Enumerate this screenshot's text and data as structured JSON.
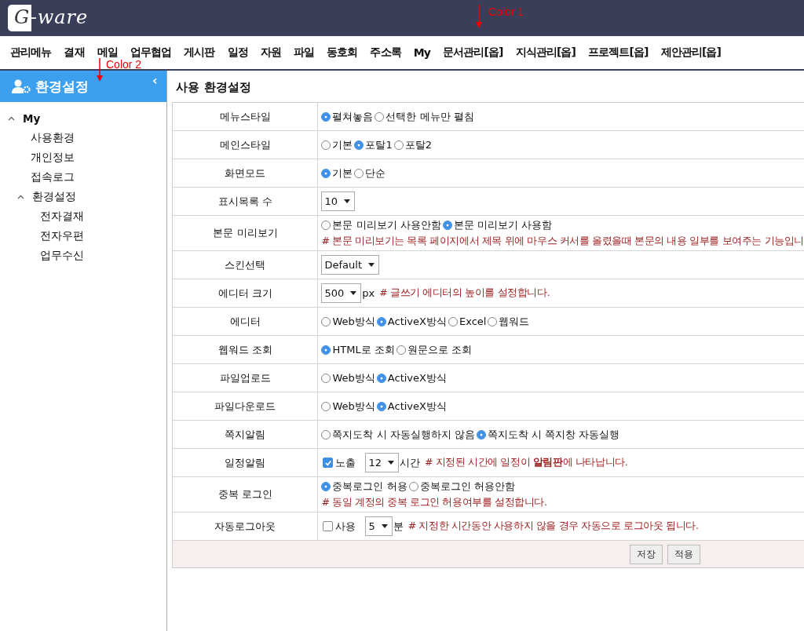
{
  "header": {
    "logo": "G-ware"
  },
  "menu": [
    "관리메뉴",
    "결재",
    "메일",
    "업무협업",
    "게시판",
    "일정",
    "자원",
    "파일",
    "동호회",
    "주소록",
    "My",
    "문서관리[옵]",
    "지식관리[옵]",
    "프로젝트[옵]",
    "제안관리[옵]"
  ],
  "sidebar": {
    "title": "환경설정",
    "collapse": "‹",
    "tree": [
      {
        "label": "My",
        "expanded": true,
        "children": [
          {
            "label": "사용환경"
          },
          {
            "label": "개인정보"
          },
          {
            "label": "접속로그"
          },
          {
            "label": "환경설정",
            "expanded": true,
            "children": [
              {
                "label": "전자결재"
              },
              {
                "label": "전자우편"
              },
              {
                "label": "업무수신"
              }
            ]
          }
        ]
      }
    ]
  },
  "page_title": "사용 환경설정",
  "settings": [
    {
      "label": "메뉴스타일",
      "lines": [
        [
          {
            "kind": "radio",
            "label": "펼쳐놓음",
            "selected": true
          },
          {
            "kind": "radio",
            "label": "선택한 메뉴만 펼침",
            "selected": false
          }
        ]
      ]
    },
    {
      "label": "메인스타일",
      "lines": [
        [
          {
            "kind": "radio",
            "label": "기본",
            "selected": false
          },
          {
            "kind": "radio",
            "label": "포탈1",
            "selected": true
          },
          {
            "kind": "radio",
            "label": "포탈2",
            "selected": false
          }
        ]
      ]
    },
    {
      "label": "화면모드",
      "lines": [
        [
          {
            "kind": "radio",
            "label": "기본",
            "selected": true
          },
          {
            "kind": "radio",
            "label": "단순",
            "selected": false
          }
        ]
      ]
    },
    {
      "label": "표시목록 수",
      "lines": [
        [
          {
            "kind": "select",
            "value": "10"
          }
        ]
      ]
    },
    {
      "label": "본문 미리보기",
      "lines": [
        [
          {
            "kind": "radio",
            "label": "본문 미리보기 사용안함",
            "selected": false
          },
          {
            "kind": "radio",
            "label": "본문 미리보기 사용함",
            "selected": true
          }
        ],
        [
          {
            "kind": "note",
            "text": "# 본문 미리보기는 목록 페이지에서 제목 위에 마우스 커서를 올렸을때 본문의 내용 일부를 보여주는 기능입니"
          }
        ]
      ]
    },
    {
      "label": "스킨선택",
      "lines": [
        [
          {
            "kind": "select",
            "value": "Default"
          }
        ]
      ]
    },
    {
      "label": "에디터 크기",
      "lines": [
        [
          {
            "kind": "select",
            "value": "500"
          },
          {
            "kind": "text",
            "text": "px"
          },
          {
            "kind": "note",
            "text": "# 글쓰기 에디터의 높이를 설정합니다."
          }
        ]
      ]
    },
    {
      "label": "에디터",
      "lines": [
        [
          {
            "kind": "radio",
            "label": "Web방식",
            "selected": false
          },
          {
            "kind": "radio",
            "label": "ActiveX방식",
            "selected": true
          },
          {
            "kind": "radio",
            "label": "Excel",
            "selected": false
          },
          {
            "kind": "radio",
            "label": "웹워드",
            "selected": false
          }
        ]
      ]
    },
    {
      "label": "웹워드 조회",
      "lines": [
        [
          {
            "kind": "radio",
            "label": "HTML로 조회",
            "selected": true
          },
          {
            "kind": "radio",
            "label": "원문으로 조회",
            "selected": false
          }
        ]
      ]
    },
    {
      "label": "파일업로드",
      "lines": [
        [
          {
            "kind": "radio",
            "label": "Web방식",
            "selected": false
          },
          {
            "kind": "radio",
            "label": "ActiveX방식",
            "selected": true
          }
        ]
      ]
    },
    {
      "label": "파일다운로드",
      "lines": [
        [
          {
            "kind": "radio",
            "label": "Web방식",
            "selected": false
          },
          {
            "kind": "radio",
            "label": "ActiveX방식",
            "selected": true
          }
        ]
      ]
    },
    {
      "label": "쪽지알림",
      "lines": [
        [
          {
            "kind": "radio",
            "label": "쪽지도착 시 자동실행하지 않음",
            "selected": false
          },
          {
            "kind": "radio",
            "label": "쪽지도착 시 쪽지창 자동실행",
            "selected": true
          }
        ]
      ]
    },
    {
      "label": "일정알림",
      "lines": [
        [
          {
            "kind": "checkbox",
            "label": "노출",
            "checked": true
          },
          {
            "kind": "select",
            "value": "12"
          },
          {
            "kind": "text",
            "text": "시간"
          },
          {
            "kind": "note",
            "text": "# 지정된 시간에 일정이 **알림판**에 나타납니다."
          }
        ]
      ]
    },
    {
      "label": "중복 로그인",
      "lines": [
        [
          {
            "kind": "radio",
            "label": "중복로그인 허용",
            "selected": true
          },
          {
            "kind": "radio",
            "label": "중복로그인 허용안함",
            "selected": false
          }
        ],
        [
          {
            "kind": "note",
            "text": "# 동일 계정의 중복 로그인 허용여부를 설정합니다."
          }
        ]
      ]
    },
    {
      "label": "자동로그아웃",
      "lines": [
        [
          {
            "kind": "checkbox",
            "label": "사용",
            "checked": false
          },
          {
            "kind": "select",
            "value": "5"
          },
          {
            "kind": "text",
            "text": "분"
          },
          {
            "kind": "note",
            "text": "# 지정한 시간동안 사용하지 않을 경우 자동으로 로그아웃 됩니다."
          }
        ]
      ]
    }
  ],
  "buttons": [
    "저장",
    "적용"
  ],
  "annotations": [
    {
      "text": "Color 1"
    },
    {
      "text": "Color 2"
    }
  ]
}
